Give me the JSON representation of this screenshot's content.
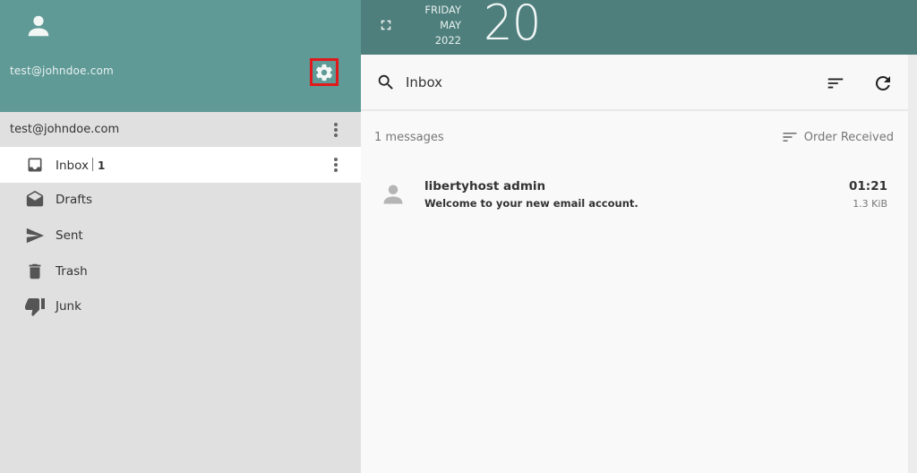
{
  "account": {
    "email": "test@johndoe.com",
    "header_email": "test@johndoe.com",
    "avatar_icon": "person-icon",
    "settings_icon": "gear-icon"
  },
  "folders": [
    {
      "label": "Inbox",
      "count": "1",
      "icon": "inbox-icon",
      "active": true
    },
    {
      "label": "Drafts",
      "icon": "drafts-icon"
    },
    {
      "label": "Sent",
      "icon": "send-icon"
    },
    {
      "label": "Trash",
      "icon": "trash-icon"
    },
    {
      "label": "Junk",
      "icon": "thumbs-down-icon"
    }
  ],
  "date": {
    "weekday": "FRIDAY",
    "month": "MAY",
    "year": "2022",
    "day": "20"
  },
  "search": {
    "value": "Inbox",
    "placeholder": ""
  },
  "list": {
    "count_label": "1 messages",
    "order_label": "Order Received"
  },
  "messages": [
    {
      "sender": "libertyhost admin",
      "subject": "Welcome to your new email account.",
      "time": "01:21",
      "size": "1.3 KiB"
    }
  ],
  "colors": {
    "header_teal": "#5f9a96",
    "topbar_teal": "#4e7f7c",
    "sidebar_bg": "#e0e0e0",
    "highlight_red": "#e0191c"
  }
}
